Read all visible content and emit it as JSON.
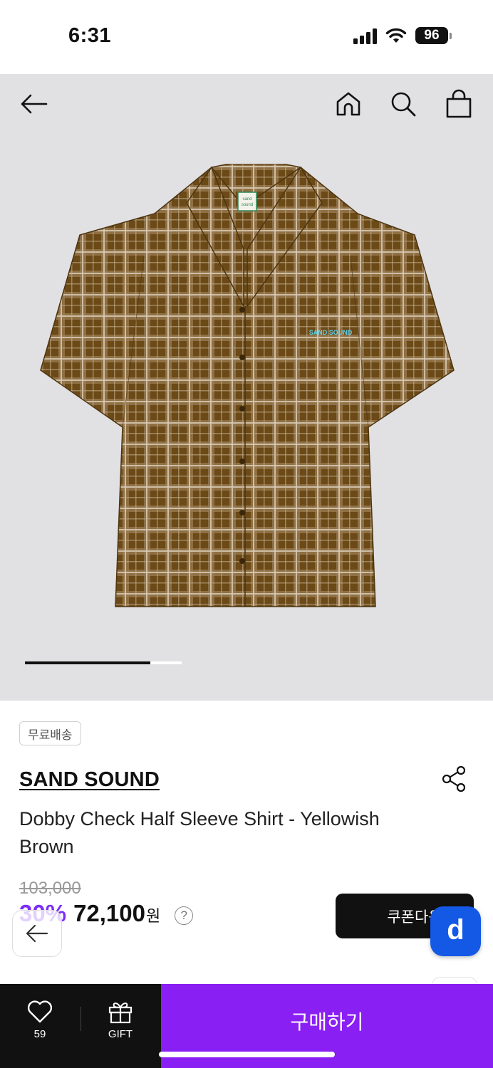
{
  "status_bar": {
    "time": "6:31",
    "battery": "96"
  },
  "header": {
    "back_icon": "arrow-left-icon",
    "home_icon": "home-icon",
    "search_icon": "search-icon",
    "cart_icon": "shopping-bag-icon"
  },
  "gallery": {
    "progress": 0.8,
    "image_label_collar": "sand sound",
    "image_label_chest": "SAND SOUND"
  },
  "product": {
    "badge": "무료배송",
    "brand": "SAND SOUND",
    "title": "Dobby Check Half Sleeve Shirt - Yellowish Brown",
    "original_price": "103,000",
    "discount": "30%",
    "sale_price": "72,100",
    "currency": "원",
    "help": "?"
  },
  "coupon": {
    "label": "쿠폰다운"
  },
  "floating": {
    "d_label": "d"
  },
  "bottom_bar": {
    "like_count": "59",
    "gift_label": "GIFT",
    "buy_label": "구매하기"
  },
  "colors": {
    "accent": "#8a1ff4",
    "discount": "#7b2ff7",
    "fab": "#1458e6",
    "shirt_base": "#6b4a17",
    "check_light": "#c9b9a4"
  }
}
